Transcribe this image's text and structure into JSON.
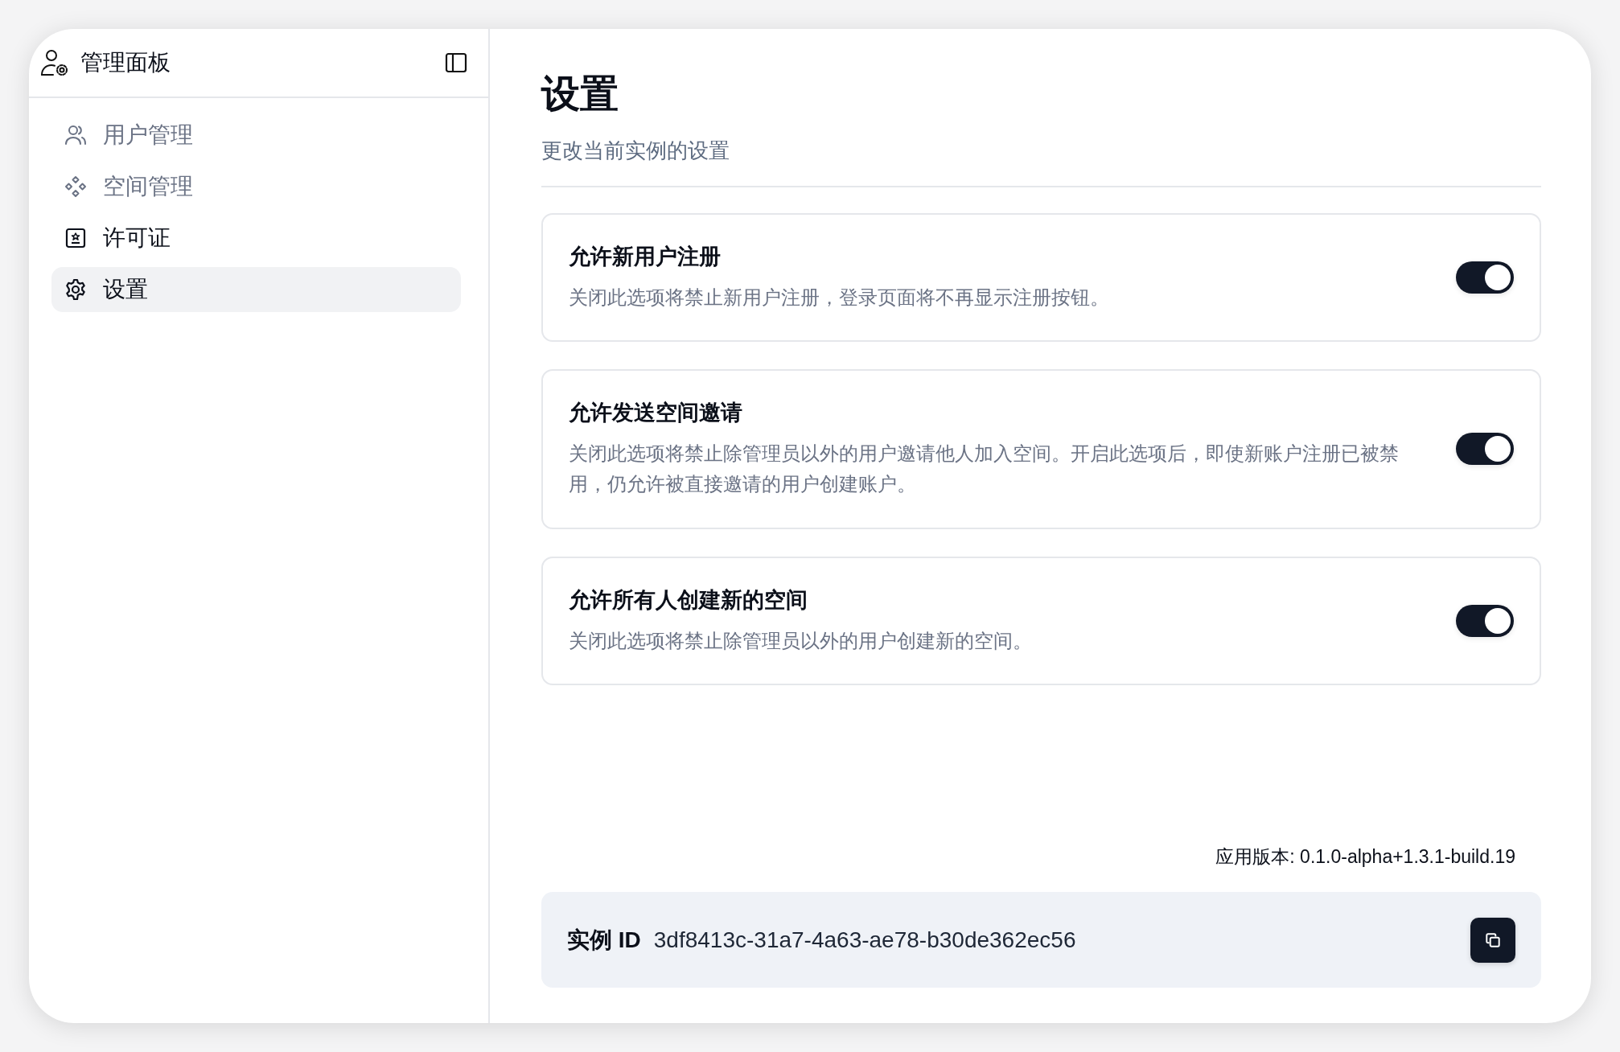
{
  "sidebar": {
    "title": "管理面板",
    "items": [
      {
        "label": "用户管理",
        "kind": "users",
        "selected": false,
        "disabled": true
      },
      {
        "label": "空间管理",
        "kind": "spaces",
        "selected": false,
        "disabled": true
      },
      {
        "label": "许可证",
        "kind": "license",
        "selected": false,
        "disabled": false
      },
      {
        "label": "设置",
        "kind": "settings",
        "selected": true,
        "disabled": false
      }
    ]
  },
  "page": {
    "title": "设置",
    "subtitle": "更改当前实例的设置"
  },
  "settings": [
    {
      "title": "允许新用户注册",
      "description": "关闭此选项将禁止新用户注册，登录页面将不再显示注册按钮。",
      "on": true
    },
    {
      "title": "允许发送空间邀请",
      "description": "关闭此选项将禁止除管理员以外的用户邀请他人加入空间。开启此选项后，即使新账户注册已被禁用，仍允许被直接邀请的用户创建账户。",
      "on": true
    },
    {
      "title": "允许所有人创建新的空间",
      "description": "关闭此选项将禁止除管理员以外的用户创建新的空间。",
      "on": true
    }
  ],
  "version": "应用版本: 0.1.0-alpha+1.3.1-build.19",
  "instance": {
    "label": "实例 ID",
    "value": "3df8413c-31a7-4a63-ae78-b30de362ec56"
  }
}
